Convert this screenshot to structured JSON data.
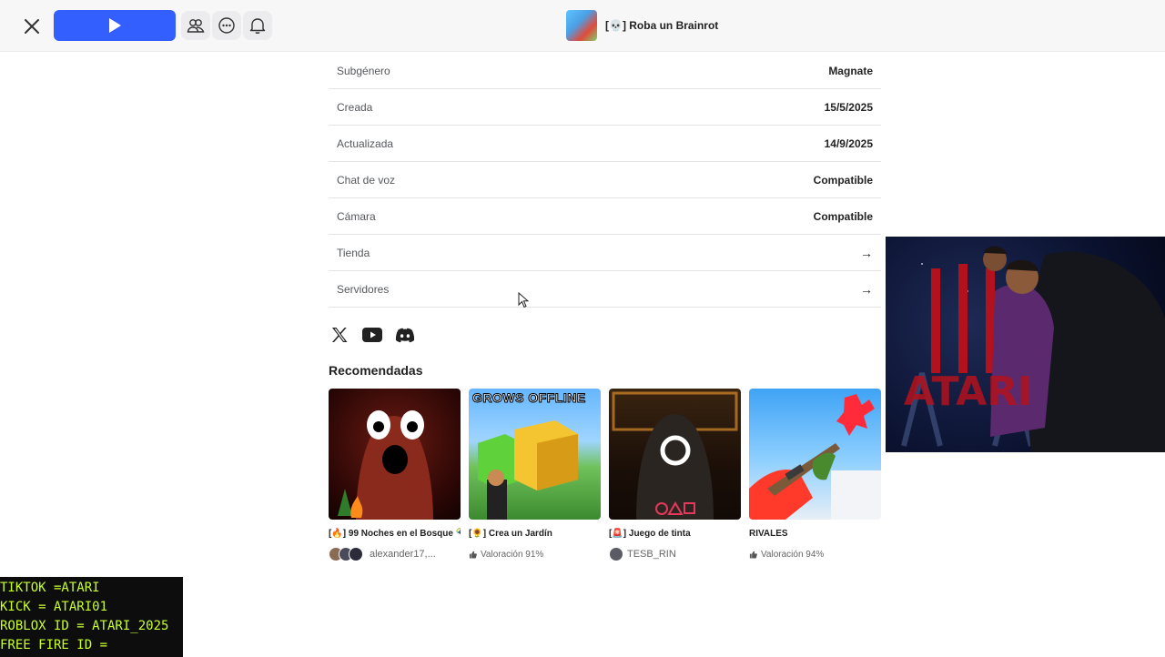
{
  "header": {
    "game_title": "[💀] Roba un Brainrot"
  },
  "details": [
    {
      "label": "Subgénero",
      "value": "Magnate"
    },
    {
      "label": "Creada",
      "value": "15/5/2025"
    },
    {
      "label": "Actualizada",
      "value": "14/9/2025"
    },
    {
      "label": "Chat de voz",
      "value": "Compatible"
    },
    {
      "label": "Cámara",
      "value": "Compatible"
    },
    {
      "label": "Tienda",
      "value": "→"
    },
    {
      "label": "Servidores",
      "value": "→"
    }
  ],
  "recommended": {
    "title": "Recomendadas",
    "games": [
      {
        "name": "[🔥] 99 Noches en el Bosque 🔦",
        "meta": "alexander17,..."
      },
      {
        "name": "[🌻] Crea un Jardín",
        "meta": "Valoración 91%"
      },
      {
        "name": "[🚨] Juego de tinta",
        "meta": "TESB_RIN"
      },
      {
        "name": "RIVALES",
        "meta": "Valoración 94%"
      }
    ],
    "card2_overlay": "GROWS OFFLINE"
  },
  "stream_overlay": {
    "lines": [
      "TIKTOK =ATARI",
      "KICK = ATARI01",
      "ROBLOX ID = ATARI_2025",
      "FREE FIRE ID ="
    ]
  },
  "webcam": {
    "watermark": "ATARI"
  },
  "colors": {
    "accent": "#335fff",
    "overlay_text": "#c7ff2a"
  }
}
